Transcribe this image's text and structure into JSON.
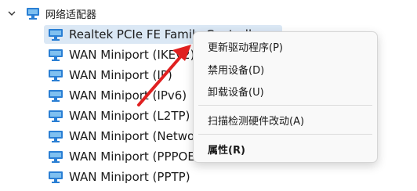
{
  "category": {
    "label": "网络适配器"
  },
  "devices": [
    {
      "label": "Realtek PCIe FE Family Controller"
    },
    {
      "label": "WAN Miniport (IKEv2)"
    },
    {
      "label": "WAN Miniport (IP)"
    },
    {
      "label": "WAN Miniport (IPv6)"
    },
    {
      "label": "WAN Miniport (L2TP)"
    },
    {
      "label": "WAN Miniport (Network Monitor)"
    },
    {
      "label": "WAN Miniport (PPPOE)"
    },
    {
      "label": "WAN Miniport (PPTP)"
    }
  ],
  "context_menu": {
    "items": [
      {
        "label": "更新驱动程序(P)"
      },
      {
        "label": "禁用设备(D)"
      },
      {
        "label": "卸载设备(U)"
      },
      {
        "label": "扫描检测硬件改动(A)"
      },
      {
        "label": "属性(R)"
      }
    ]
  },
  "colors": {
    "selected_row": "#dbe8f5",
    "arrow": "#e02020",
    "icon_blue": "#2a7fd4"
  },
  "icons": {
    "category": "network-adapter-icon",
    "device": "network-adapter-icon",
    "expand": "chevron-down-icon"
  }
}
